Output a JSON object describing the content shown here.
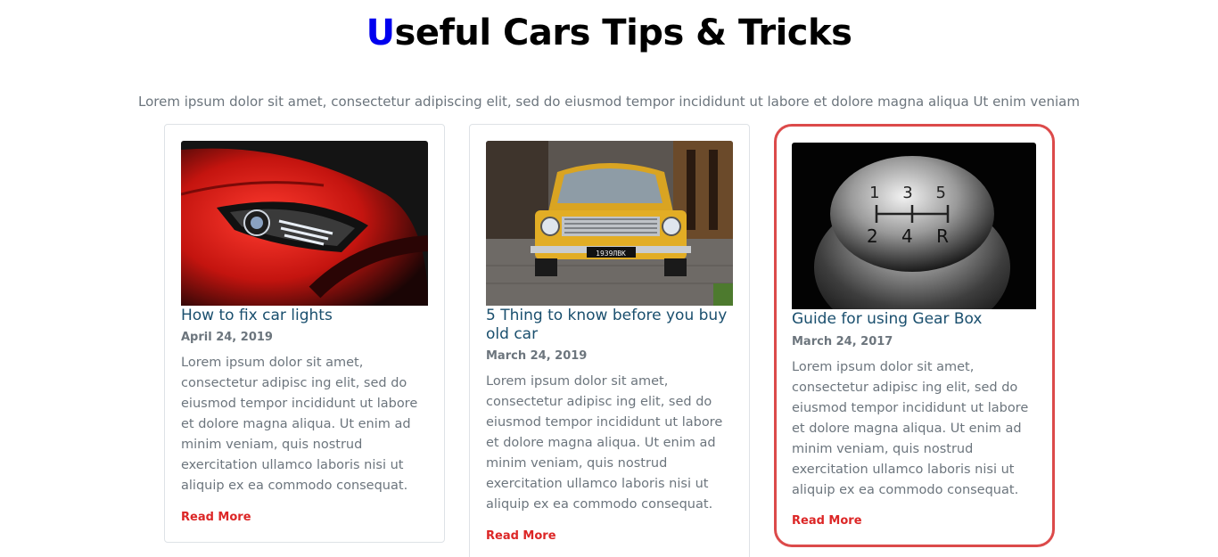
{
  "header": {
    "title_accent": "U",
    "title_rest": "seful Cars Tips & Tricks",
    "subtitle": "Lorem ipsum dolor sit amet, consectetur adipiscing elit, sed do eiusmod tempor incididunt ut labore et dolore magna aliqua Ut enim veniam"
  },
  "colors": {
    "accent": "#0000ee",
    "title_link": "#1a4f6e",
    "read_more": "#dc2626",
    "highlight_border": "#dc4a4a"
  },
  "cards": [
    {
      "title": "How to fix car lights",
      "date": "April 24, 2019",
      "text": "Lorem ipsum dolor sit amet, consectetur adipisc ing elit, sed do eiusmod tempor incididunt ut labore et dolore magna aliqua. Ut enim ad minim veniam, quis nostrud exercitation ullamco laboris nisi ut aliquip ex ea commodo consequat.",
      "link": "Read More",
      "image": "red-sports-car-headlight"
    },
    {
      "title": "5 Thing to know before you buy old car",
      "date": "March 24, 2019",
      "text": "Lorem ipsum dolor sit amet, consectetur adipisc ing elit, sed do eiusmod tempor incididunt ut labore et dolore magna aliqua. Ut enim ad minim veniam, quis nostrud exercitation ullamco laboris nisi ut aliquip ex ea commodo consequat.",
      "link": "Read More",
      "image": "yellow-vintage-car",
      "plate": "1939ЛВК"
    },
    {
      "title": "Guide for using Gear Box",
      "date": "March 24, 2017",
      "text": "Lorem ipsum dolor sit amet, consectetur adipisc ing elit, sed do eiusmod tempor incididunt ut labore et dolore magna aliqua. Ut enim ad minim veniam, quis nostrud exercitation ullamco laboris nisi ut aliquip ex ea commodo consequat.",
      "link": "Read More",
      "image": "gear-shift-knob",
      "gear_top": "1 3 5",
      "gear_bottom": "2 4 R"
    }
  ]
}
